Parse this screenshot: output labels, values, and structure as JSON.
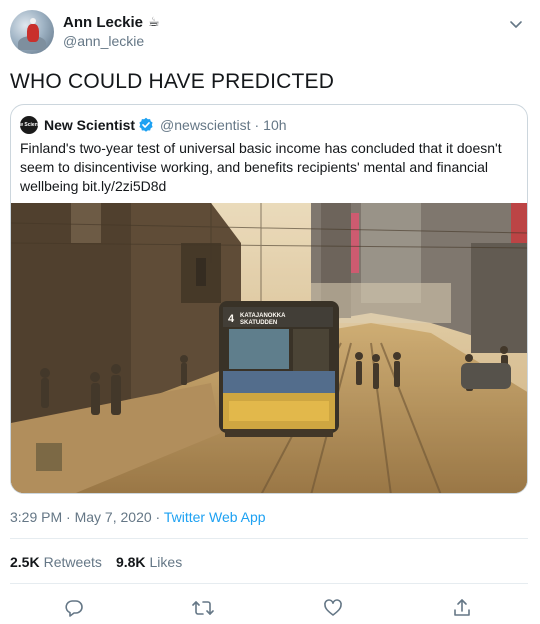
{
  "author": {
    "name": "Ann Leckie",
    "emoji": "☕",
    "handle": "@ann_leckie"
  },
  "tweet_text": "WHO COULD HAVE PREDICTED",
  "quoted": {
    "logo_text": "New Scientist",
    "name": "New Scientist",
    "handle": "@newscientist",
    "separator": "·",
    "time": "10h",
    "body": "Finland's two-year test of universal basic income has concluded that it doesn't seem to disincentivise working, and benefits recipients' mental and financial wellbeing bit.ly/2zi5D8d",
    "photo": {
      "tram_number": "4",
      "tram_destination_1": "KATAJANOKKA",
      "tram_destination_2": "SKATUDDEN"
    }
  },
  "meta": {
    "time": "3:29 PM",
    "dot1": "·",
    "date": "May 7, 2020",
    "dot2": "·",
    "source": "Twitter Web App"
  },
  "stats": {
    "retweets_count": "2.5K",
    "retweets_label": "Retweets",
    "likes_count": "9.8K",
    "likes_label": "Likes"
  },
  "icons": {
    "menu": "chevron-down-icon",
    "verified": "verified-badge-icon",
    "reply": "reply-icon",
    "retweet": "retweet-icon",
    "like": "heart-icon",
    "share": "share-icon"
  },
  "colors": {
    "accent": "#1da1f2",
    "secondary_text": "#657786",
    "border": "#ccd6dd"
  }
}
